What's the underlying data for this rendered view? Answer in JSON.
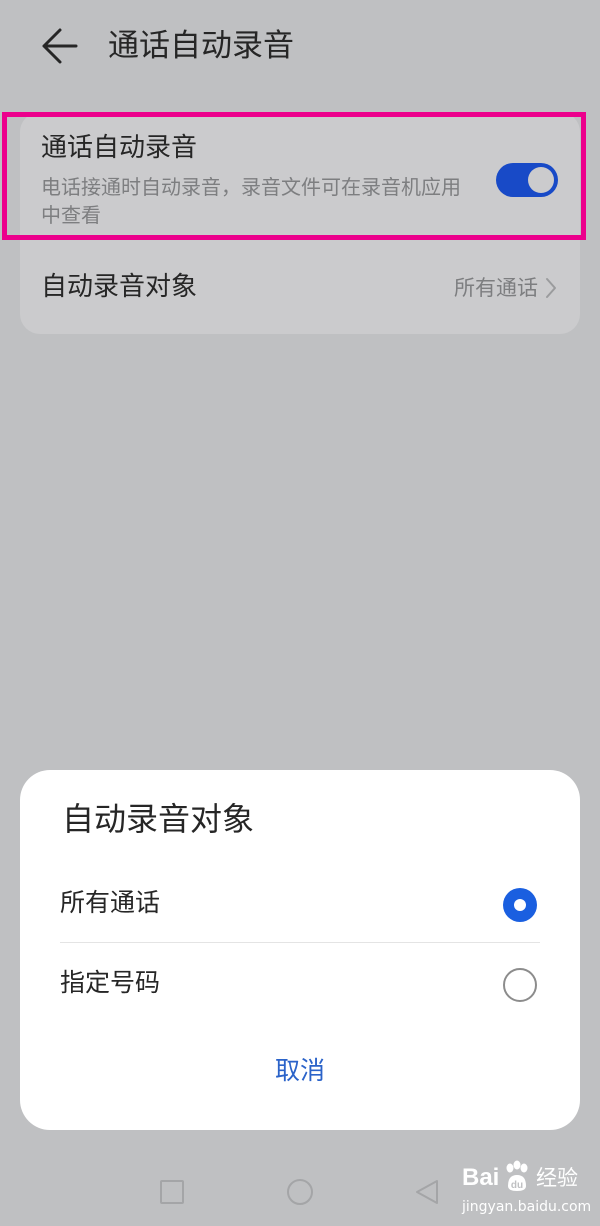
{
  "header": {
    "back_icon": "arrow-left-icon",
    "title": "通话自动录音"
  },
  "settings": {
    "auto_record": {
      "title": "通话自动录音",
      "description": "电话接通时自动录音，录音文件可在录音机应用中查看",
      "enabled": true
    },
    "record_target": {
      "label": "自动录音对象",
      "value": "所有通话",
      "chevron_icon": "chevron-right-icon"
    }
  },
  "dialog": {
    "title": "自动录音对象",
    "options": [
      {
        "label": "所有通话",
        "selected": true
      },
      {
        "label": "指定号码",
        "selected": false
      }
    ],
    "cancel_label": "取消"
  },
  "navbar": {
    "recents_icon": "square-icon",
    "home_icon": "circle-icon",
    "back_icon": "triangle-back-icon"
  },
  "watermark": {
    "logo": "Bai",
    "logo_icon": "paw-icon",
    "text": "经验",
    "url": "jingyan.baidu.com"
  },
  "colors": {
    "accent": "#184ac7",
    "highlight": "#ec008c",
    "link": "#2b63c9",
    "background": "#bfc0c2"
  }
}
